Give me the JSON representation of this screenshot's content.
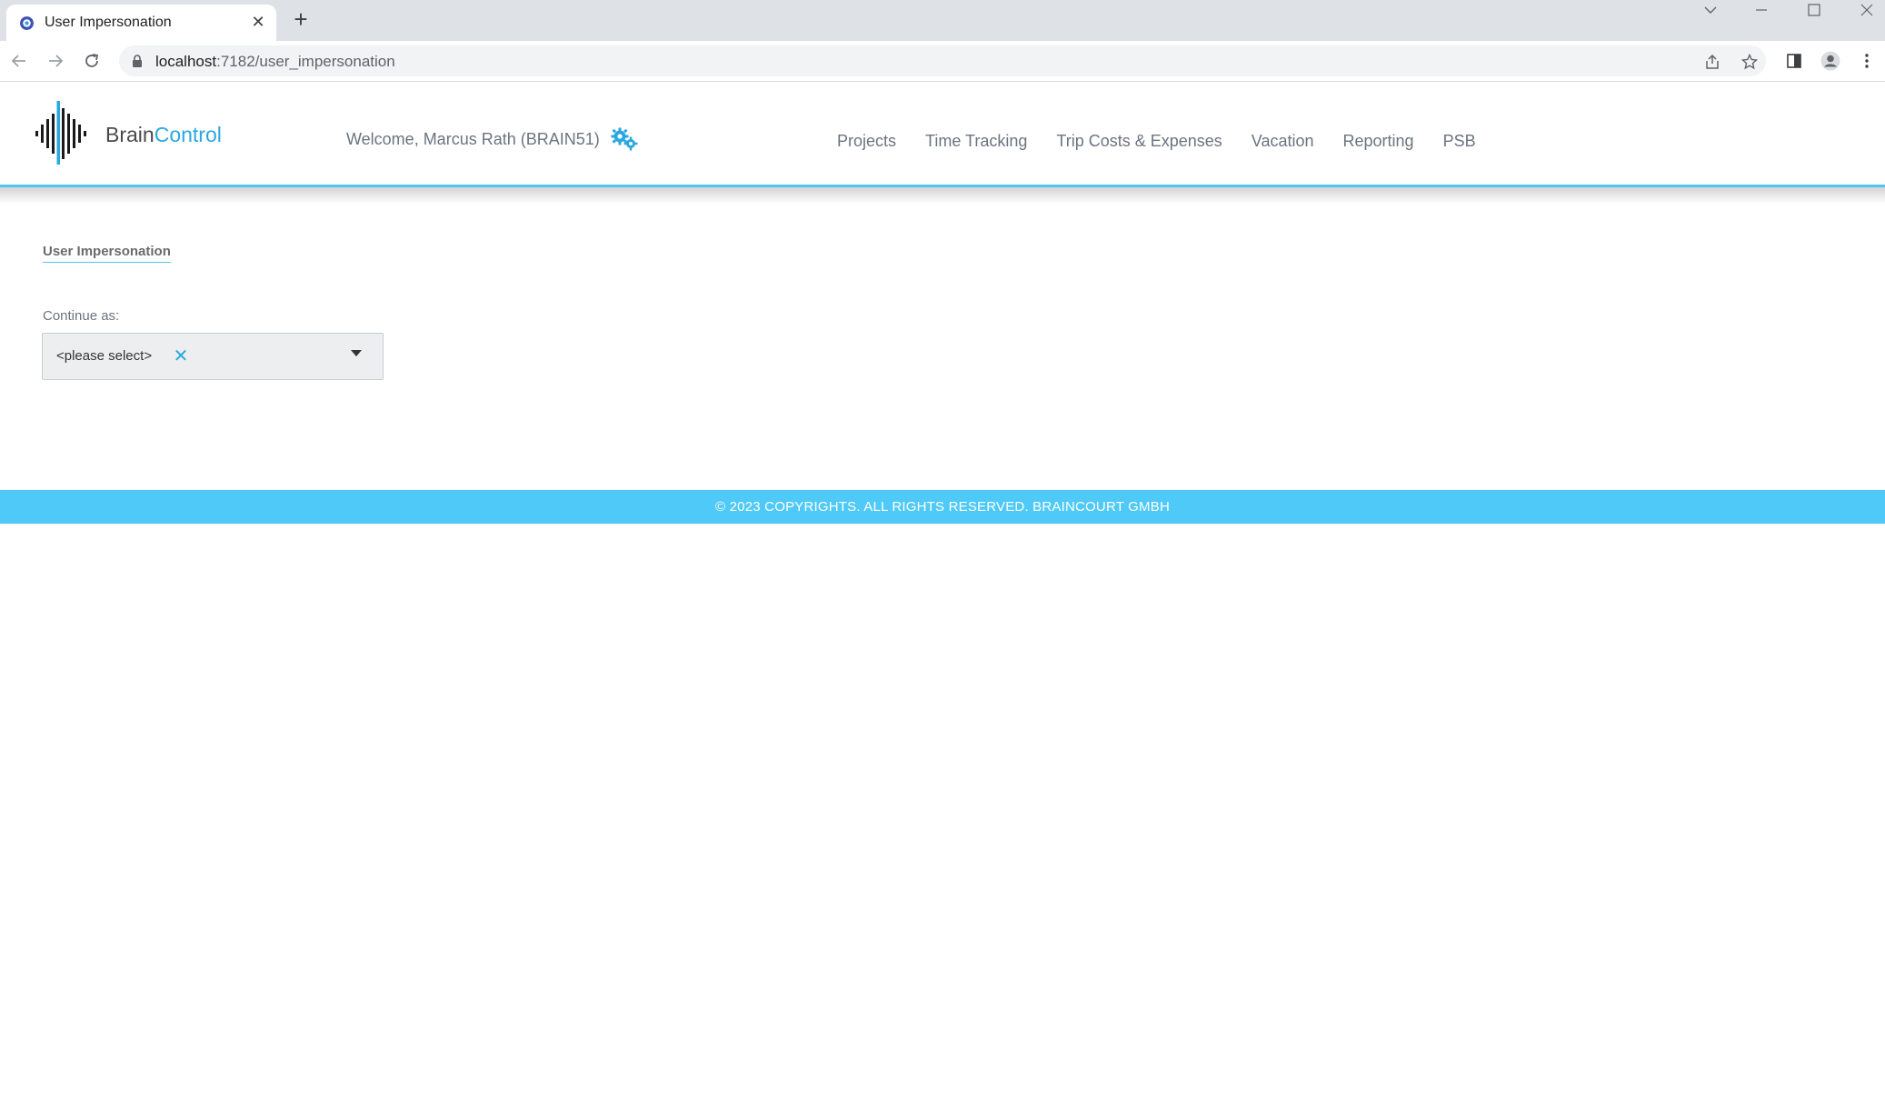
{
  "browser": {
    "tab_title": "User Impersonation",
    "tab_close_glyph": "✕",
    "new_tab_glyph": "+",
    "url_host": "localhost",
    "url_path": ":7182/user_impersonation"
  },
  "app": {
    "logo_brain": "Brain",
    "logo_control": "Control",
    "welcome": "Welcome, Marcus Rath (BRAIN51)",
    "nav": [
      {
        "label": "Projects"
      },
      {
        "label": "Time Tracking"
      },
      {
        "label": "Trip Costs & Expenses"
      },
      {
        "label": "Vacation"
      },
      {
        "label": "Reporting"
      },
      {
        "label": "PSB"
      }
    ]
  },
  "page": {
    "title": "User Impersonation",
    "field_label": "Continue as:",
    "select_value": "<please select>",
    "clear_glyph": "✕"
  },
  "footer": {
    "text": "© 2023 COPYRIGHTS. ALL RIGHTS RESERVED. BRAINCOURT GMBH"
  },
  "colors": {
    "accent": "#4fc6f2",
    "footer_bg": "#4fc9f7",
    "logo_blue": "#29a8e0",
    "nav_text": "#6a7480"
  },
  "icons": [
    "favicon-icon",
    "close-icon",
    "plus-icon",
    "back-icon",
    "forward-icon",
    "reload-icon",
    "lock-icon",
    "share-icon",
    "star-icon",
    "sidepanel-icon",
    "profile-icon",
    "menu-icon",
    "gears-icon",
    "clear-icon",
    "dropdown-arrow-icon"
  ]
}
